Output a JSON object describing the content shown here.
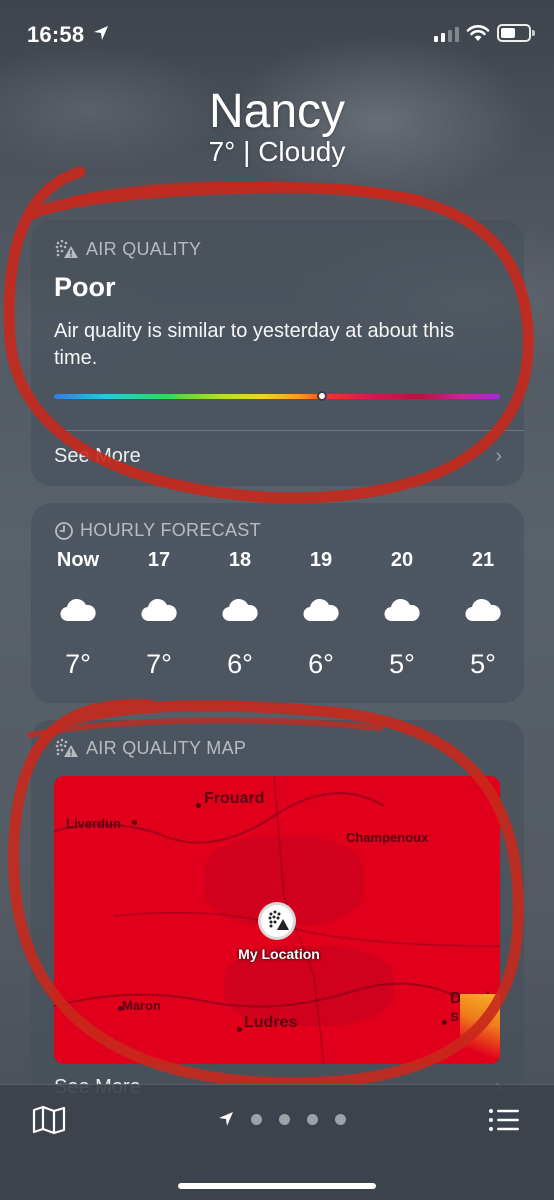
{
  "status_bar": {
    "time": "16:58"
  },
  "header": {
    "city": "Nancy",
    "condition": "7°  |  Cloudy"
  },
  "air_quality": {
    "header": "AIR QUALITY",
    "level": "Poor",
    "description": "Air quality is similar to yesterday at about this time.",
    "see_more": "See More",
    "indicator_fraction": 0.6
  },
  "hourly": {
    "header": "HOURLY FORECAST",
    "items": [
      {
        "hour": "Now",
        "temp": "7°",
        "icon": "cloud-icon"
      },
      {
        "hour": "17",
        "temp": "7°",
        "icon": "cloud-icon"
      },
      {
        "hour": "18",
        "temp": "6°",
        "icon": "cloud-icon"
      },
      {
        "hour": "19",
        "temp": "6°",
        "icon": "cloud-icon"
      },
      {
        "hour": "20",
        "temp": "5°",
        "icon": "cloud-icon"
      },
      {
        "hour": "21",
        "temp": "5°",
        "icon": "cloud-icon"
      }
    ]
  },
  "aq_map": {
    "header": "AIR QUALITY MAP",
    "places": {
      "frouard": "Frouard",
      "liverdun": "Liverdun",
      "champenoux": "Champenoux",
      "maron": "Maron",
      "ludres": "Ludres",
      "dombasle_1": "Domb",
      "dombasle_2": "sur-M"
    },
    "my_location": "My Location",
    "see_more": "See More"
  },
  "colors": {
    "map_red": "#e0001c",
    "annotation_red": "#c8281c"
  }
}
